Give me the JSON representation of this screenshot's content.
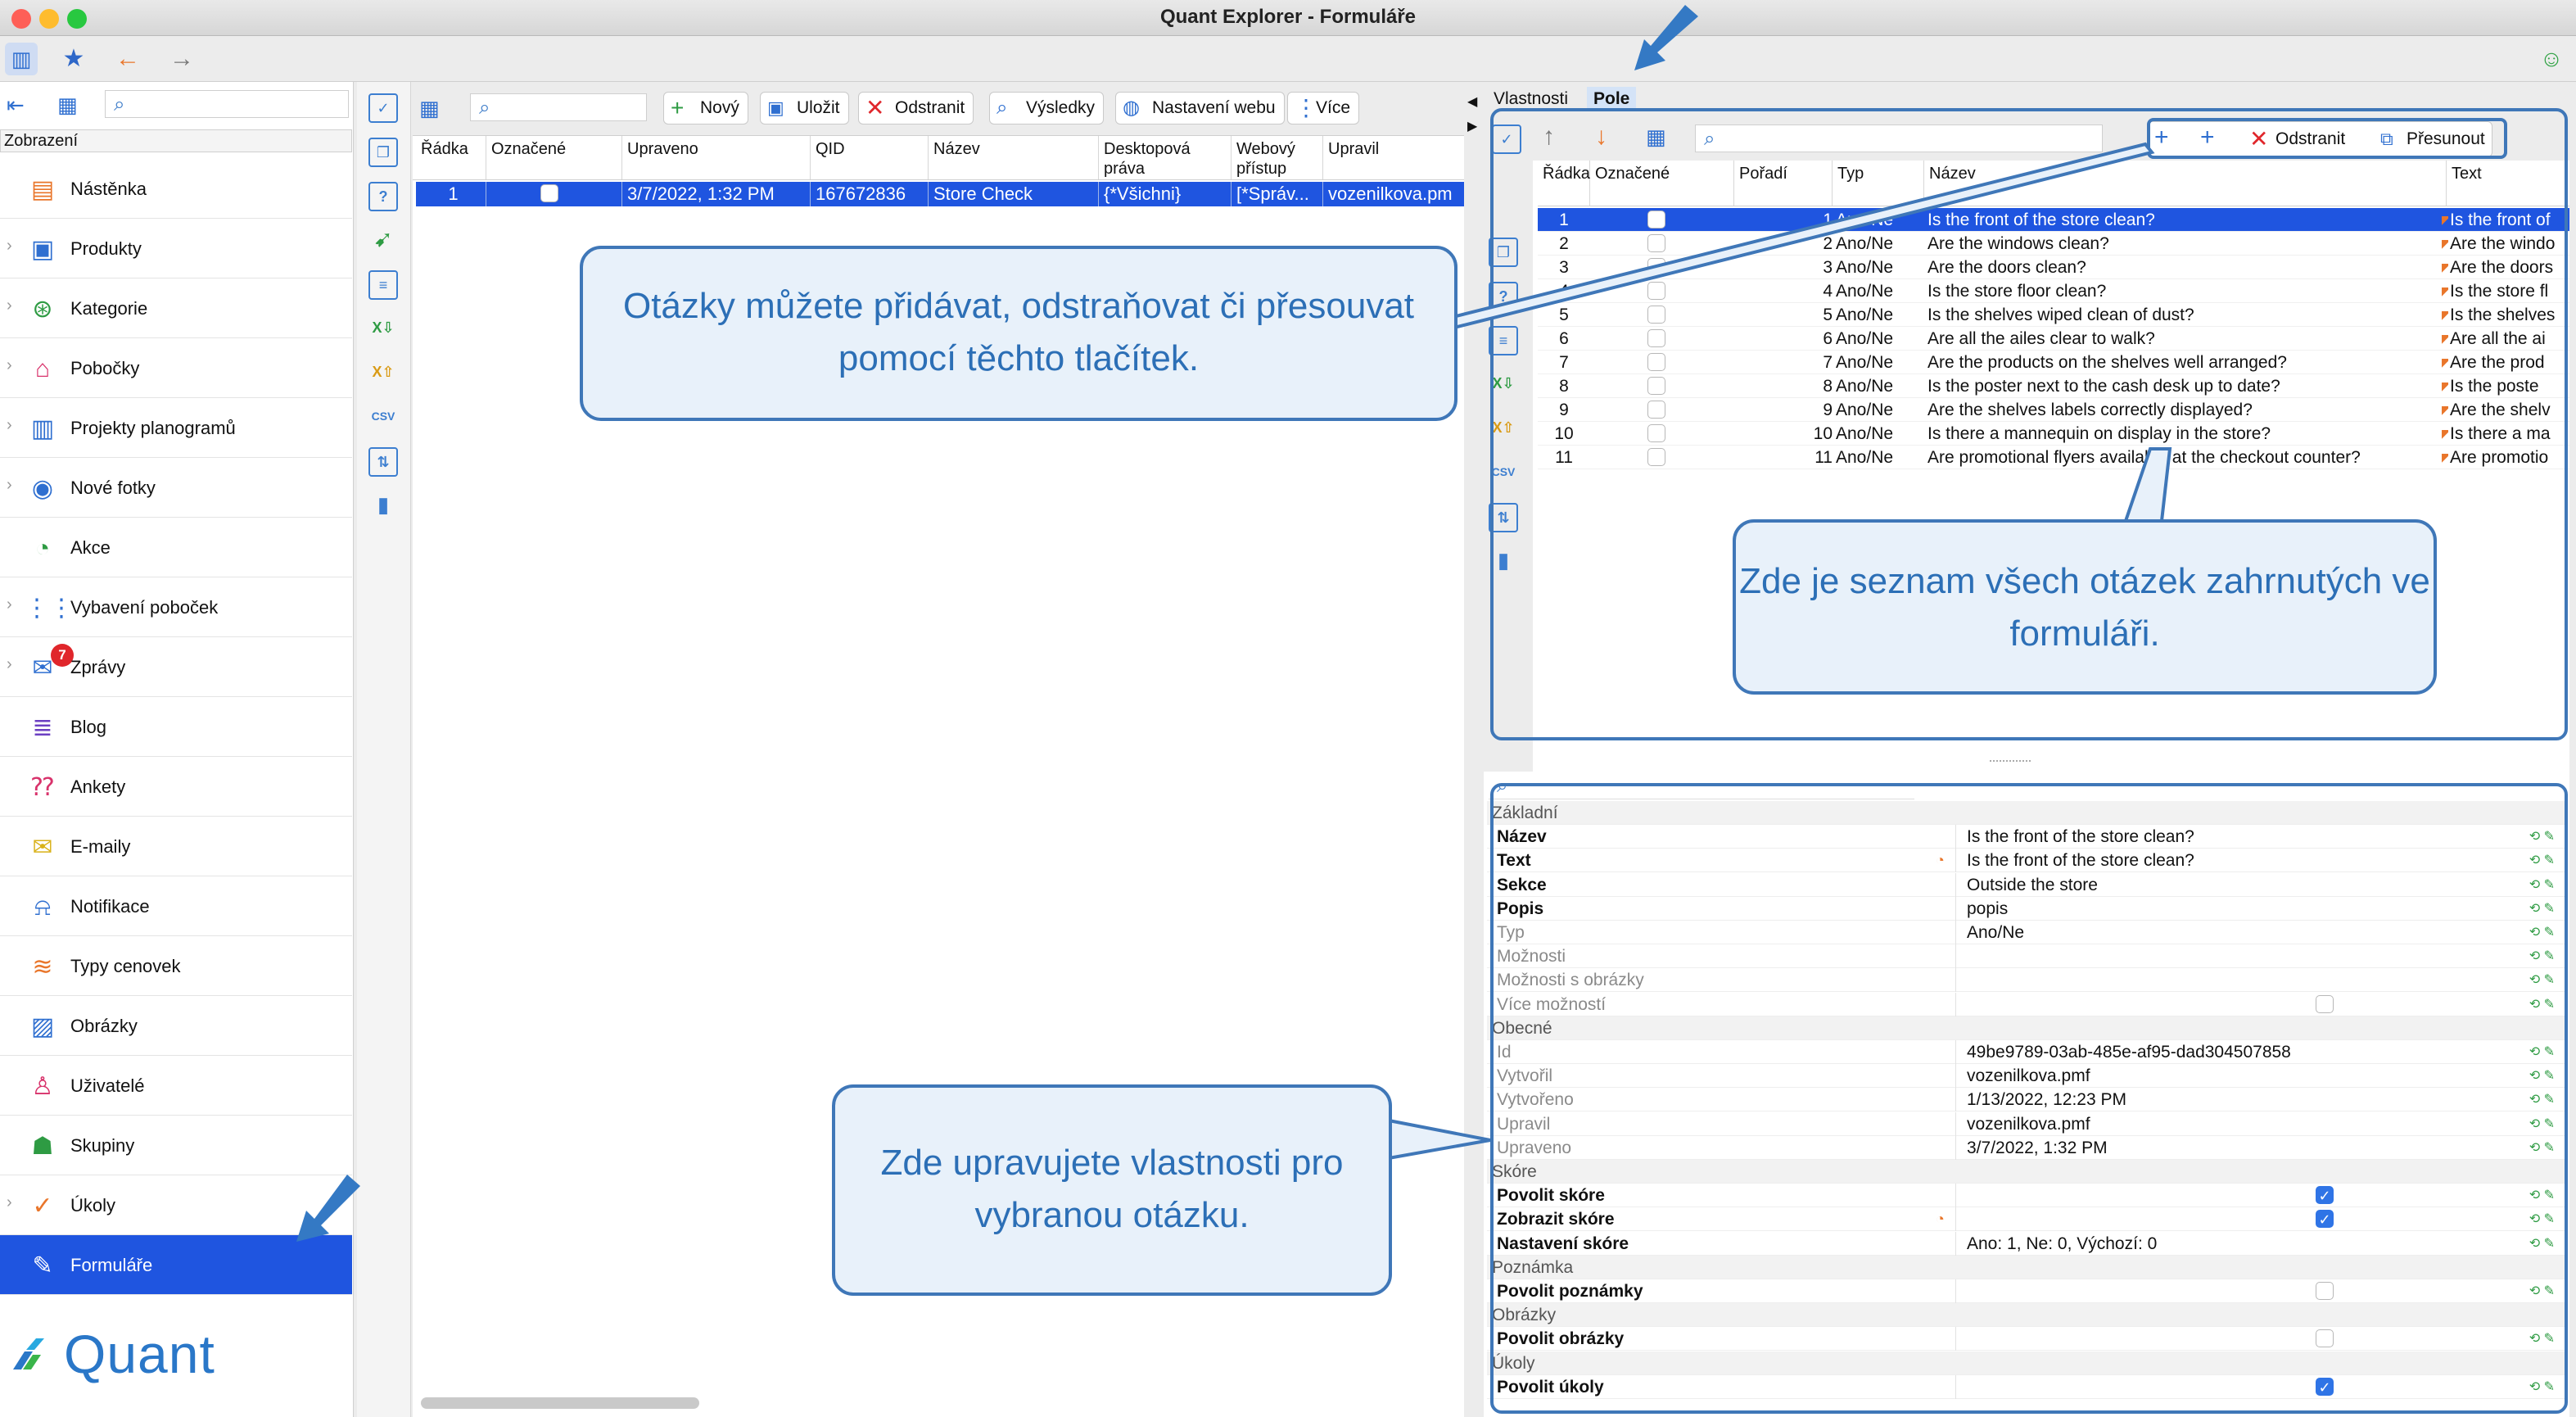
{
  "window": {
    "title": "Quant Explorer - Formuláře"
  },
  "left": {
    "header": "Zobrazení",
    "nav": [
      {
        "label": "Nástěnka",
        "icon": "dashboard-icon",
        "chev": false
      },
      {
        "label": "Produkty",
        "icon": "product-icon",
        "chev": true
      },
      {
        "label": "Kategorie",
        "icon": "category-icon",
        "chev": true
      },
      {
        "label": "Pobočky",
        "icon": "store-icon",
        "chev": true
      },
      {
        "label": "Projekty planogramů",
        "icon": "planogram-icon",
        "chev": true
      },
      {
        "label": "Nové fotky",
        "icon": "camera-icon",
        "chev": true
      },
      {
        "label": "Akce",
        "icon": "clock-icon",
        "chev": false
      },
      {
        "label": "Vybavení poboček",
        "icon": "equipment-icon",
        "chev": true
      },
      {
        "label": "Zprávy",
        "icon": "message-icon",
        "chev": true,
        "badge": "7"
      },
      {
        "label": "Blog",
        "icon": "blog-icon",
        "chev": false
      },
      {
        "label": "Ankety",
        "icon": "survey-icon",
        "chev": false
      },
      {
        "label": "E-maily",
        "icon": "email-icon",
        "chev": false
      },
      {
        "label": "Notifikace",
        "icon": "bell-icon",
        "chev": false
      },
      {
        "label": "Typy cenovek",
        "icon": "price-tag-icon",
        "chev": false
      },
      {
        "label": "Obrázky",
        "icon": "image-icon",
        "chev": false
      },
      {
        "label": "Uživatelé",
        "icon": "user-icon",
        "chev": false
      },
      {
        "label": "Skupiny",
        "icon": "group-icon",
        "chev": false
      },
      {
        "label": "Úkoly",
        "icon": "task-icon",
        "chev": true
      },
      {
        "label": "Formuláře",
        "icon": "form-icon",
        "chev": false,
        "selected": true
      }
    ],
    "brand": "Quant"
  },
  "mid": {
    "toolbar": {
      "new": "Nový",
      "save": "Uložit",
      "delete": "Odstranit",
      "results": "Výsledky",
      "web": "Nastavení webu",
      "more": "Více"
    },
    "columns": [
      "Řádka",
      "Označené",
      "Upraveno",
      "QID",
      "Název",
      "Desktopová práva",
      "Webový přístup",
      "Upravil"
    ],
    "rows": [
      {
        "row": "1",
        "modified": "3/7/2022, 1:32 PM",
        "qid": "167672836",
        "name": "Store Check",
        "desktop": "{*Všichni}",
        "web": "[*Správ...",
        "by": "vozenilkova.pm"
      }
    ]
  },
  "right": {
    "tabs": [
      "Vlastnosti",
      "Pole"
    ],
    "toolbar": {
      "delete": "Odstranit",
      "move": "Přesunout"
    },
    "columns": [
      "Řádka",
      "Označené",
      "Pořadí",
      "Typ",
      "Název",
      "Text"
    ],
    "questions": [
      {
        "row": "1",
        "order": "1",
        "type": "Ano/Ne",
        "name": "Is the front of the store clean?",
        "text": "Is the front of"
      },
      {
        "row": "2",
        "order": "2",
        "type": "Ano/Ne",
        "name": "Are the windows clean?",
        "text": "Are the windo"
      },
      {
        "row": "3",
        "order": "3",
        "type": "Ano/Ne",
        "name": "Are the doors clean?",
        "text": "Are the doors"
      },
      {
        "row": "4",
        "order": "4",
        "type": "Ano/Ne",
        "name": "Is the store floor clean?",
        "text": "Is the store fl"
      },
      {
        "row": "5",
        "order": "5",
        "type": "Ano/Ne",
        "name": "Is the shelves wiped clean of dust?",
        "text": "Is the shelves"
      },
      {
        "row": "6",
        "order": "6",
        "type": "Ano/Ne",
        "name": "Are all the ailes clear to walk?",
        "text": "Are all the ai"
      },
      {
        "row": "7",
        "order": "7",
        "type": "Ano/Ne",
        "name": "Are the products on the shelves well arranged?",
        "text": "Are the prod"
      },
      {
        "row": "8",
        "order": "8",
        "type": "Ano/Ne",
        "name": "Is the poster next to the cash desk up to date?",
        "text": "Is the poste"
      },
      {
        "row": "9",
        "order": "9",
        "type": "Ano/Ne",
        "name": "Are the shelves labels correctly displayed?",
        "text": "Are the shelv"
      },
      {
        "row": "10",
        "order": "10",
        "type": "Ano/Ne",
        "name": "Is there a mannequin on display in the store?",
        "text": "Is there a ma"
      },
      {
        "row": "11",
        "order": "11",
        "type": "Ano/Ne",
        "name": "Are promotional flyers available at the checkout counter?",
        "text": "Are promotio"
      }
    ],
    "props": [
      {
        "g": "Základní"
      },
      {
        "l": "Název",
        "v": "Is the front of the store clean?",
        "b": true
      },
      {
        "l": "Text",
        "v": "Is the front of the store clean?",
        "b": true,
        "flag": true
      },
      {
        "l": "Sekce",
        "v": "Outside the store",
        "b": true
      },
      {
        "l": "Popis",
        "v": "popis",
        "b": true
      },
      {
        "l": "Typ",
        "v": "Ano/Ne"
      },
      {
        "l": "Možnosti",
        "v": ""
      },
      {
        "l": "Možnosti s obrázky",
        "v": ""
      },
      {
        "l": "Více možností",
        "v": "",
        "cb": "off"
      },
      {
        "g": "Obecné"
      },
      {
        "l": "Id",
        "v": "49be9789-03ab-485e-af95-dad304507858"
      },
      {
        "l": "Vytvořil",
        "v": "vozenilkova.pmf"
      },
      {
        "l": "Vytvořeno",
        "v": "1/13/2022, 12:23 PM"
      },
      {
        "l": "Upravil",
        "v": "vozenilkova.pmf"
      },
      {
        "l": "Upraveno",
        "v": "3/7/2022, 1:32 PM"
      },
      {
        "g": "Skóre"
      },
      {
        "l": "Povolit skóre",
        "v": "",
        "cb": "on",
        "b": true
      },
      {
        "l": "Zobrazit skóre",
        "v": "",
        "cb": "on",
        "b": true,
        "flag": true
      },
      {
        "l": "Nastavení skóre",
        "v": "Ano: 1, Ne: 0, Výchozí: 0",
        "b": true
      },
      {
        "g": "Poznámka"
      },
      {
        "l": "Povolit poznámky",
        "v": "",
        "cb": "off",
        "b": true
      },
      {
        "g": "Obrázky"
      },
      {
        "l": "Povolit obrázky",
        "v": "",
        "cb": "off",
        "b": true
      },
      {
        "g": "Úkoly"
      },
      {
        "l": "Povolit úkoly",
        "v": "",
        "cb": "on",
        "b": true
      }
    ]
  },
  "callouts": {
    "buttons": "Otázky můžete přidávat, odstraňovat či přesouvat pomocí těchto tlačítek.",
    "list": "Zde je seznam všech otázek zahrnutých ve formuláři.",
    "props": "Zde upravujete vlastnosti pro vybranou otázku."
  }
}
